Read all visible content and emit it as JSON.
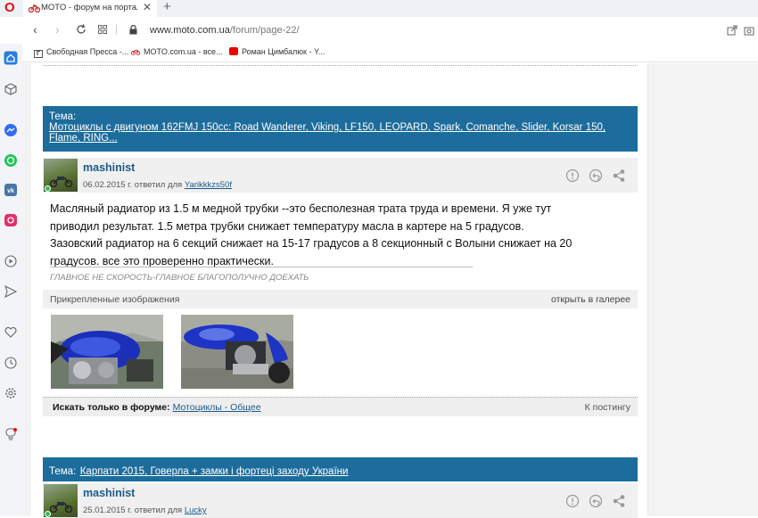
{
  "browser": {
    "tab_title": "MOTO - форум на портале M",
    "url_domain": "www.moto.com.ua",
    "url_path": "/forum/page-22/",
    "bookmarks": [
      {
        "label": "Свободная Пресса -..."
      },
      {
        "label": "MOTO.com.ua - все..."
      },
      {
        "label": "Роман Цимбалюк - Y..."
      }
    ]
  },
  "sidebar": {
    "icons": [
      "home-icon",
      "cube-icon",
      "messenger-icon",
      "whatsapp-icon",
      "vk-icon",
      "instagram-icon",
      "player-icon",
      "send-icon",
      "heart-icon",
      "history-icon",
      "settings-icon",
      "bulb-icon"
    ]
  },
  "thread1": {
    "label": "Тема:",
    "title": "Мотоциклы с двигуном 162FMJ 150cc: Road Wanderer, Viking, LF150, LEOPARD, Spark, Comanche, Slider, Korsar 150,",
    "title_cont": "Flame, RING..."
  },
  "post1": {
    "author": "mashinist",
    "date_text": "06.02.2015 г. ответил для",
    "reply_to": "Yarikkkzs50f",
    "body": "Масляный радиатор из 1.5 м медной трубки --это бесполезная трата труда и времени.  Я уже тут\nприводил результат.       1.5 метра трубки снижает температуру масла в картере на 5 градусов.\nЗазовский радиатор на 6 секций снижает на 15-17 градусов а 8 секционный с Волыни снижает на 20\nградусов. все это проверенно практически.",
    "signature": "ГЛАВНОЕ НЕ СКОРОСТЬ-ГЛАВНОЕ БЛАГОПОЛУЧНО ДОЕХАТЬ",
    "attachments_label": "Прикрепленные изображения",
    "gallery_link": "открыть в галерее",
    "search_label": "Искать только в форуме:",
    "forum_name": "Мотоциклы - Общее",
    "to_post": "К постингу"
  },
  "thread2": {
    "label": "Тема:",
    "title": "Карпати 2015, Говерла + замки і фортеці заходу України"
  },
  "post2": {
    "author": "mashinist",
    "date_text": "25.01.2015 г. ответил для",
    "reply_to": "Lucky"
  },
  "colors": {
    "thread_header": "#1c6c9c",
    "author": "#1c5a88"
  }
}
